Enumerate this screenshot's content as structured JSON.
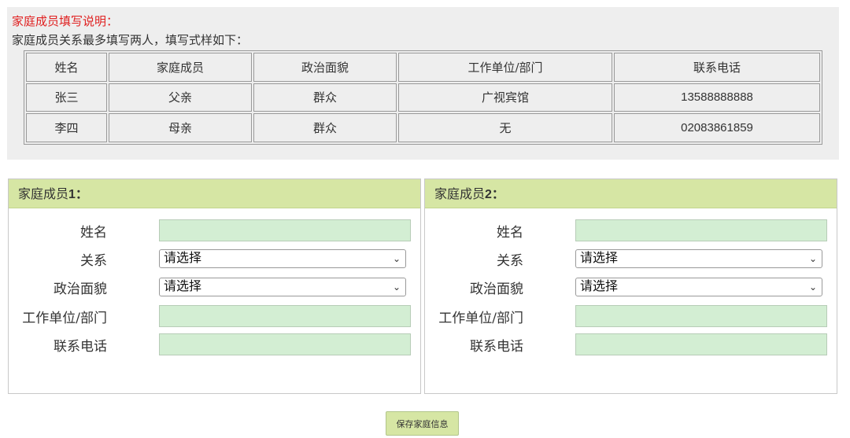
{
  "instructions": {
    "title": "家庭成员填写说明：",
    "text": "家庭成员关系最多填写两人，填写式样如下：",
    "table": {
      "headers": [
        "姓名",
        "家庭成员",
        "政治面貌",
        "工作单位/部门",
        "联系电话"
      ],
      "rows": [
        [
          "张三",
          "父亲",
          "群众",
          "广视宾馆",
          "13588888888"
        ],
        [
          "李四",
          "母亲",
          "群众",
          "无",
          "02083861859"
        ]
      ]
    }
  },
  "panels": [
    {
      "header_text": "家庭成员",
      "header_num": "1：",
      "fields": {
        "name_label": "姓名",
        "relation_label": "关系",
        "relation_value": "请选择",
        "political_label": "政治面貌",
        "political_value": "请选择",
        "work_label": "工作单位/部门",
        "phone_label": "联系电话"
      }
    },
    {
      "header_text": "家庭成员",
      "header_num": "2：",
      "fields": {
        "name_label": "姓名",
        "relation_label": "关系",
        "relation_value": "请选择",
        "political_label": "政治面貌",
        "political_value": "请选择",
        "work_label": "工作单位/部门",
        "phone_label": "联系电话"
      }
    }
  ],
  "save_button": {
    "label": "保存家庭信息"
  },
  "colors": {
    "instruction_title": "#e02020",
    "panel_header": "#d6e6a4",
    "input_fill": "#d3eed3"
  }
}
